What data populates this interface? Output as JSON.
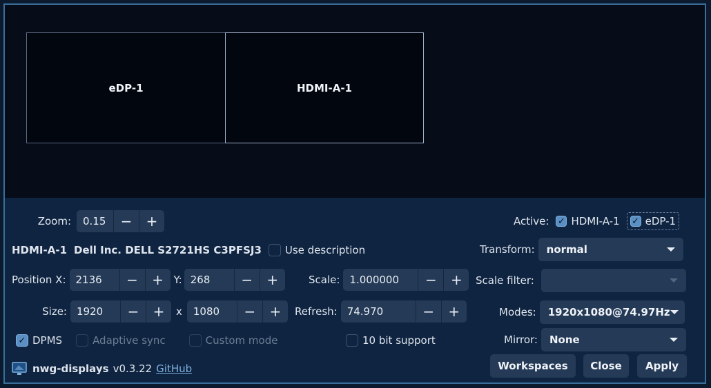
{
  "outputs": [
    {
      "name": "eDP-1"
    },
    {
      "name": "HDMI-A-1"
    }
  ],
  "zoom": {
    "label": "Zoom:",
    "value": "0.15"
  },
  "active": {
    "label": "Active:",
    "items": [
      {
        "name": "HDMI-A-1",
        "checked": true
      },
      {
        "name": "eDP-1",
        "checked": true
      }
    ]
  },
  "selected_output": {
    "name": "HDMI-A-1",
    "description": "Dell Inc. DELL S2721HS C3PFSJ3",
    "use_description_label": "Use description"
  },
  "transform": {
    "label": "Transform:",
    "value": "normal"
  },
  "position": {
    "x_label": "Position X:",
    "x_value": "2136",
    "y_label": "Y:",
    "y_value": "268"
  },
  "scale": {
    "label": "Scale:",
    "value": "1.000000"
  },
  "scale_filter": {
    "label": "Scale filter:",
    "value": ""
  },
  "size": {
    "label": "Size:",
    "width": "1920",
    "sep": "x",
    "height": "1080"
  },
  "refresh": {
    "label": "Refresh:",
    "value": "74.970"
  },
  "modes": {
    "label": "Modes:",
    "value": "1920x1080@74.97Hz"
  },
  "options": {
    "dpms": "DPMS",
    "adaptive_sync": "Adaptive sync",
    "custom_mode": "Custom mode",
    "ten_bit": "10 bit support"
  },
  "mirror": {
    "label": "Mirror:",
    "value": "None"
  },
  "footer": {
    "app_name": "nwg-displays",
    "version": "v0.3.22",
    "github": "GitHub",
    "workspaces": "Workspaces",
    "close": "Close",
    "apply": "Apply"
  },
  "spin": {
    "minus": "−",
    "plus": "+"
  },
  "colors": {
    "accent": "#5a8fc4",
    "panel": "#0f2440",
    "canvas": "#060c18"
  }
}
